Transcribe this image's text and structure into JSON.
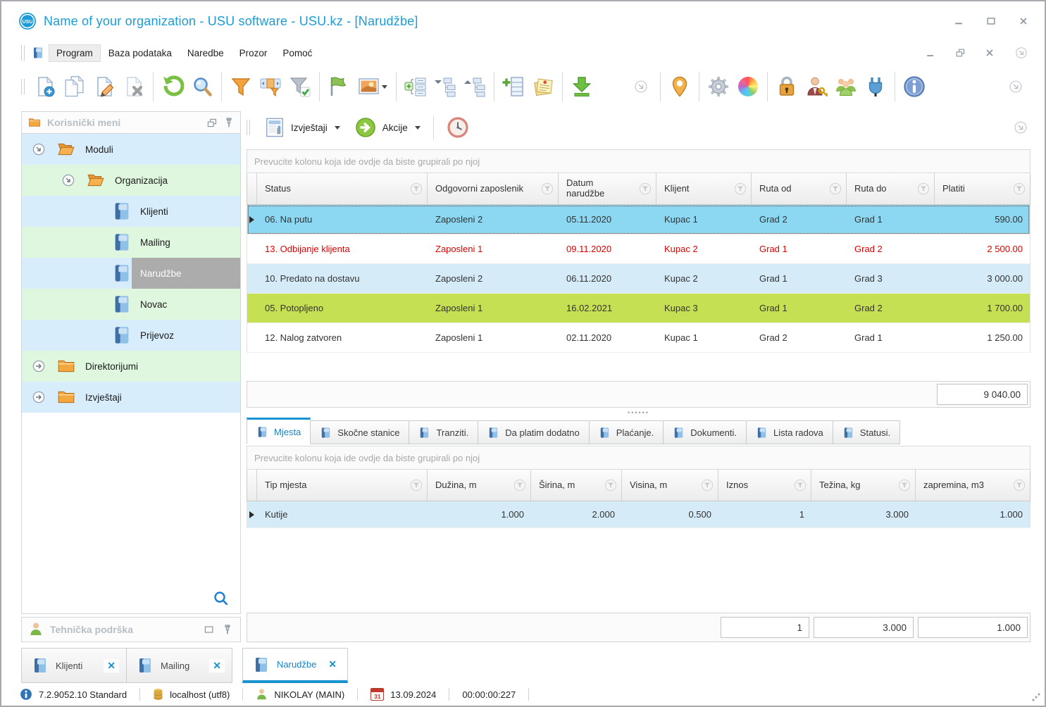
{
  "window": {
    "title": "Name of your organization - USU software - USU.kz - [Narudžbe]"
  },
  "menu": {
    "items": [
      {
        "label": "Program"
      },
      {
        "label": "Baza podataka"
      },
      {
        "label": "Naredbe"
      },
      {
        "label": "Prozor"
      },
      {
        "label": "Pomoć"
      }
    ]
  },
  "toolbar": {
    "icons": [
      "add-record",
      "copy-record",
      "edit-record",
      "delete-record",
      "refresh",
      "search",
      "filter",
      "filter-custom",
      "filter-apply",
      "flag",
      "image-view",
      "expand-groups",
      "collapse-tree",
      "expand-tree",
      "add-subrecord",
      "notes",
      "export-download",
      "scroll-more",
      "location-pin",
      "settings-gear",
      "color-theme",
      "lock",
      "user-key",
      "user-groups",
      "plugin",
      "info"
    ]
  },
  "report_bar": {
    "reports_label": "Izvještaji",
    "actions_label": "Akcije"
  },
  "sidebar": {
    "title": "Korisnički meni",
    "items": [
      {
        "label": "Moduli"
      },
      {
        "label": "Organizacija"
      },
      {
        "label": "Klijenti"
      },
      {
        "label": "Mailing"
      },
      {
        "label": "Narudžbe"
      },
      {
        "label": "Novac"
      },
      {
        "label": "Prijevoz"
      },
      {
        "label": "Direktorijumi"
      },
      {
        "label": "Izvještaji"
      }
    ],
    "support_title": "Tehnička podrška"
  },
  "orders": {
    "group_hint": "Prevucite kolonu koja ide ovdje da biste grupirali po njoj",
    "columns": [
      {
        "label": "Status"
      },
      {
        "label": "Odgovorni zaposlenik"
      },
      {
        "label": "Datum narudžbe"
      },
      {
        "label": "Klijent"
      },
      {
        "label": "Ruta od"
      },
      {
        "label": "Ruta do"
      },
      {
        "label": "Platiti"
      }
    ],
    "rows": [
      {
        "status": "06. Na putu",
        "employee": "Zaposleni 2",
        "date": "05.11.2020",
        "client": "Kupac 1",
        "route_from": "Grad 2",
        "route_to": "Grad 1",
        "pay": "590.00"
      },
      {
        "status": "13. Odbijanje klijenta",
        "employee": "Zaposleni 1",
        "date": "09.11.2020",
        "client": "Kupac 2",
        "route_from": "Grad 1",
        "route_to": "Grad 2",
        "pay": "2 500.00"
      },
      {
        "status": "10. Predato na dostavu",
        "employee": "Zaposleni 2",
        "date": "06.11.2020",
        "client": "Kupac 2",
        "route_from": "Grad 1",
        "route_to": "Grad 3",
        "pay": "3 000.00"
      },
      {
        "status": "05. Potopljeno",
        "employee": "Zaposleni 1",
        "date": "16.02.2021",
        "client": "Kupac 3",
        "route_from": "Grad 1",
        "route_to": "Grad 2",
        "pay": "1 700.00"
      },
      {
        "status": "12. Nalog zatvoren",
        "employee": "Zaposleni 1",
        "date": "02.11.2020",
        "client": "Kupac 1",
        "route_from": "Grad 2",
        "route_to": "Grad 1",
        "pay": "1 250.00"
      }
    ],
    "total": "9 040.00"
  },
  "detail_tabs": [
    {
      "label": "Mjesta"
    },
    {
      "label": "Skočne stanice"
    },
    {
      "label": "Tranziti."
    },
    {
      "label": "Da platim dodatno"
    },
    {
      "label": "Plaćanje."
    },
    {
      "label": "Dokumenti."
    },
    {
      "label": "Lista radova"
    },
    {
      "label": "Statusi."
    }
  ],
  "places": {
    "group_hint": "Prevucite kolonu koja ide ovdje da biste grupirali po njoj",
    "columns": [
      {
        "label": "Tip mjesta"
      },
      {
        "label": "Dužina, m"
      },
      {
        "label": "Širina, m"
      },
      {
        "label": "Visina, m"
      },
      {
        "label": "Iznos"
      },
      {
        "label": "Težina, kg"
      },
      {
        "label": "zapremina, m3"
      }
    ],
    "rows": [
      {
        "type": "Kutije",
        "length": "1.000",
        "width": "2.000",
        "height": "0.500",
        "amount": "1",
        "weight": "3.000",
        "volume": "1.000"
      }
    ],
    "totals": {
      "amount": "1",
      "weight": "3.000",
      "volume": "1.000"
    }
  },
  "bottom_tabs": [
    {
      "label": "Klijenti"
    },
    {
      "label": "Mailing"
    },
    {
      "label": "Narudžbe"
    }
  ],
  "status_bar": {
    "version": "7.2.9052.10 Standard",
    "database": "localhost (utf8)",
    "user": "NIKOLAY (MAIN)",
    "calendar_day": "31",
    "date": "13.09.2024",
    "timer": "00:00:00:227"
  },
  "colors": {
    "accent_blue": "#1793d0",
    "title_blue": "#1b9cd8",
    "selected_row": "#8cd8f2",
    "row_blue": "#d6ebf8",
    "row_green": "#c5e052",
    "row_red_text": "#e00000",
    "tree_blue": "#d8edfb",
    "tree_green": "#def7de",
    "tree_selected": "#acacac"
  }
}
